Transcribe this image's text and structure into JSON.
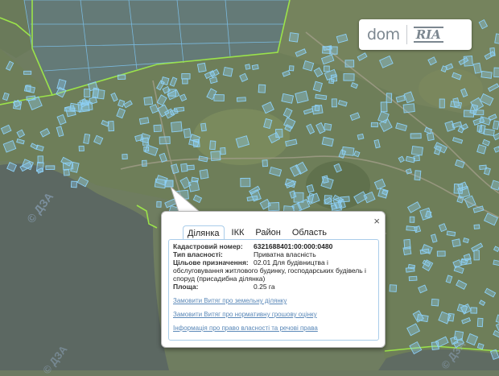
{
  "brand": {
    "part1": "dom",
    "part2": "RIA"
  },
  "watermark": "© ДЗА",
  "popup": {
    "close_icon": "×",
    "tabs": [
      {
        "label": "Ділянка",
        "active": true
      },
      {
        "label": "ІКК",
        "active": false
      },
      {
        "label": "Район",
        "active": false
      },
      {
        "label": "Область",
        "active": false
      }
    ],
    "fields": {
      "cadastral_label": "Кадастровий номер:",
      "cadastral_value": "6321688401:00:000:0480",
      "ownership_label": "Тип власності:",
      "ownership_value": "Приватна власність",
      "purpose_label": "Цільове призначення:",
      "purpose_value_line1": "02.01 Для будівництва і",
      "purpose_value_line2": "обслуговування житлового будинку, господарських будівель і",
      "purpose_value_line3": "споруд (присадибна ділянка)",
      "area_label": "Площа:",
      "area_value": "0.25 га"
    },
    "links": [
      "Замовити Витяг про земельну ділянку",
      "Замовити Витяг про нормативну грошову оцінку",
      "Інформація про право власності та речові права"
    ]
  },
  "colors": {
    "parcel_outline": "#7fc6f2",
    "parcel_fill": "#8fd0f5",
    "boundary": "#9be34a",
    "water": "#5c6862",
    "land": "#6d7b5e"
  }
}
